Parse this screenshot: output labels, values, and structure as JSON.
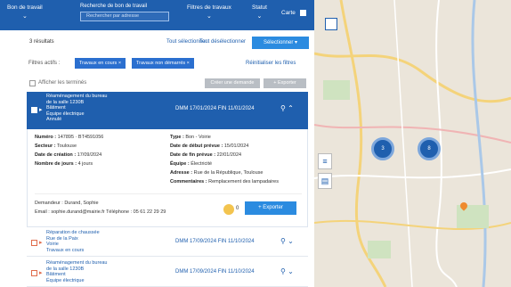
{
  "topbar": {
    "menu_label": "Bon de travail",
    "search_label": "Recherche de bon de travail",
    "search_placeholder": "Rechercher par adresse",
    "filter_label": "Filtres de travaux",
    "sort_label": "Statut",
    "toggle_label": "Carte"
  },
  "toolbar": {
    "result_count": "3 résultats",
    "select_all": "Tout sélectionner",
    "deselect_all": "Tout désélectionner",
    "select_button": "Sélectionner ▾"
  },
  "filters": {
    "label": "Filtres actifs :",
    "chips": [
      "Travaux en cours ×",
      "Travaux non démarrés ×"
    ],
    "reset": "Réinitialiser les filtres"
  },
  "bulk": {
    "checkbox_label": "Afficher les terminés",
    "action1": "Créer une demande",
    "action2": "+ Exporter"
  },
  "selected_card": {
    "names": [
      "Réaménagement du bureau",
      "de la salle 1230B",
      "Bâtiment",
      "Équipe électrique",
      "Annulé"
    ],
    "dates": "DMM 17/01/2024    FIN 11/01/2024",
    "icons": "⚲ ⌃",
    "fields": [
      {
        "k": "Numéro :",
        "v": "147895 · BT4591056"
      },
      {
        "k": "Type :",
        "v": "Bon - Voirie"
      },
      {
        "k": "Secteur :",
        "v": "Toulouse"
      },
      {
        "k": "Date de début prévue :",
        "v": "15/01/2024"
      },
      {
        "k": "Date de création :",
        "v": "17/09/2024"
      },
      {
        "k": "Date de fin prévue :",
        "v": "22/01/2024"
      },
      {
        "k": "Nombre de jours :",
        "v": "4 jours"
      },
      {
        "k": "Équipe :",
        "v": "Électricité"
      },
      {
        "k": "Adresse :",
        "v": "Rue de la République, Toulouse"
      },
      {
        "k": "Commentaires :",
        "v": "Remplacement des lampadaires"
      }
    ],
    "footer1": "Demandeur : Durand, Sophie",
    "footer2": "Email : sophie.durand@mairie.fr   Téléphone : 05 61 22 29 29",
    "badge_count": "0",
    "export": "+ Exporter"
  },
  "items": [
    {
      "names": [
        "Réparation de chaussée",
        "Rue de la Paix",
        "Voirie",
        "Travaux en cours"
      ],
      "dates": "DMM 17/09/2024    FIN 11/10/2024",
      "icons": "⚲ ⌄"
    },
    {
      "names": [
        "Réaménagement du bureau",
        "de la salle 1230B",
        "Bâtiment",
        "Équipe électrique"
      ],
      "dates": "DMM 17/09/2024    FIN 11/10/2024",
      "icons": "⚲ ⌄"
    }
  ],
  "map": {
    "clusters": [
      "3",
      "8"
    ],
    "controls": [
      "layers-icon",
      "list-icon",
      "filter-icon"
    ]
  }
}
